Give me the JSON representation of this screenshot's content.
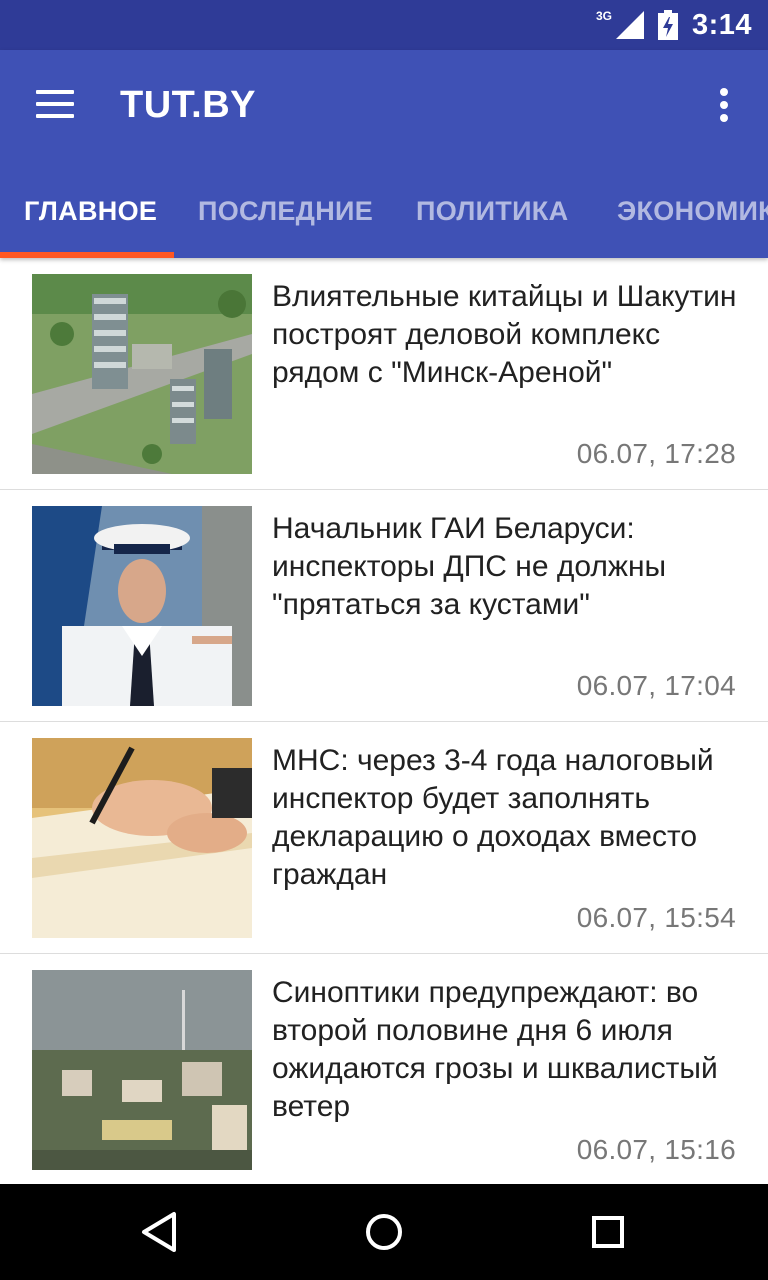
{
  "status_bar": {
    "network": "3G",
    "time": "3:14"
  },
  "app_bar": {
    "title": "TUT.BY"
  },
  "tabs": [
    {
      "label": "ГЛАВНОЕ",
      "active": true
    },
    {
      "label": "ПОСЛЕДНИЕ",
      "active": false
    },
    {
      "label": "ПОЛИТИКА",
      "active": false
    },
    {
      "label": "ЭКОНОМИКА",
      "active": false
    }
  ],
  "colors": {
    "primary": "#3f51b5",
    "status_bar": "#2f3b97",
    "tab_indicator": "#ff5722"
  },
  "news": [
    {
      "title": "Влиятельные китайцы и Шакутин построят деловой комплекс рядом с \"Минск-Ареной\"",
      "time": "06.07, 17:28",
      "image": "business-complex-rendering"
    },
    {
      "title": "Начальник ГАИ Беларуси: инспекторы ДПС не должны \"прятаться за кустами\"",
      "time": "06.07, 17:04",
      "image": "traffic-police-chief-photo"
    },
    {
      "title": "МНС: через 3-4 года налоговый инспектор будет заполнять декларацию о доходах вместо граждан",
      "time": "06.07, 15:54",
      "image": "hand-signing-document-photo"
    },
    {
      "title": "Синоптики предупреждают: во второй половине дня 6 июля ожидаются грозы и шквалистый ветер",
      "time": "06.07, 15:16",
      "image": "stormy-city-photo"
    }
  ],
  "nav_bar": {
    "icons": [
      "back-icon",
      "home-icon",
      "recents-icon"
    ]
  }
}
